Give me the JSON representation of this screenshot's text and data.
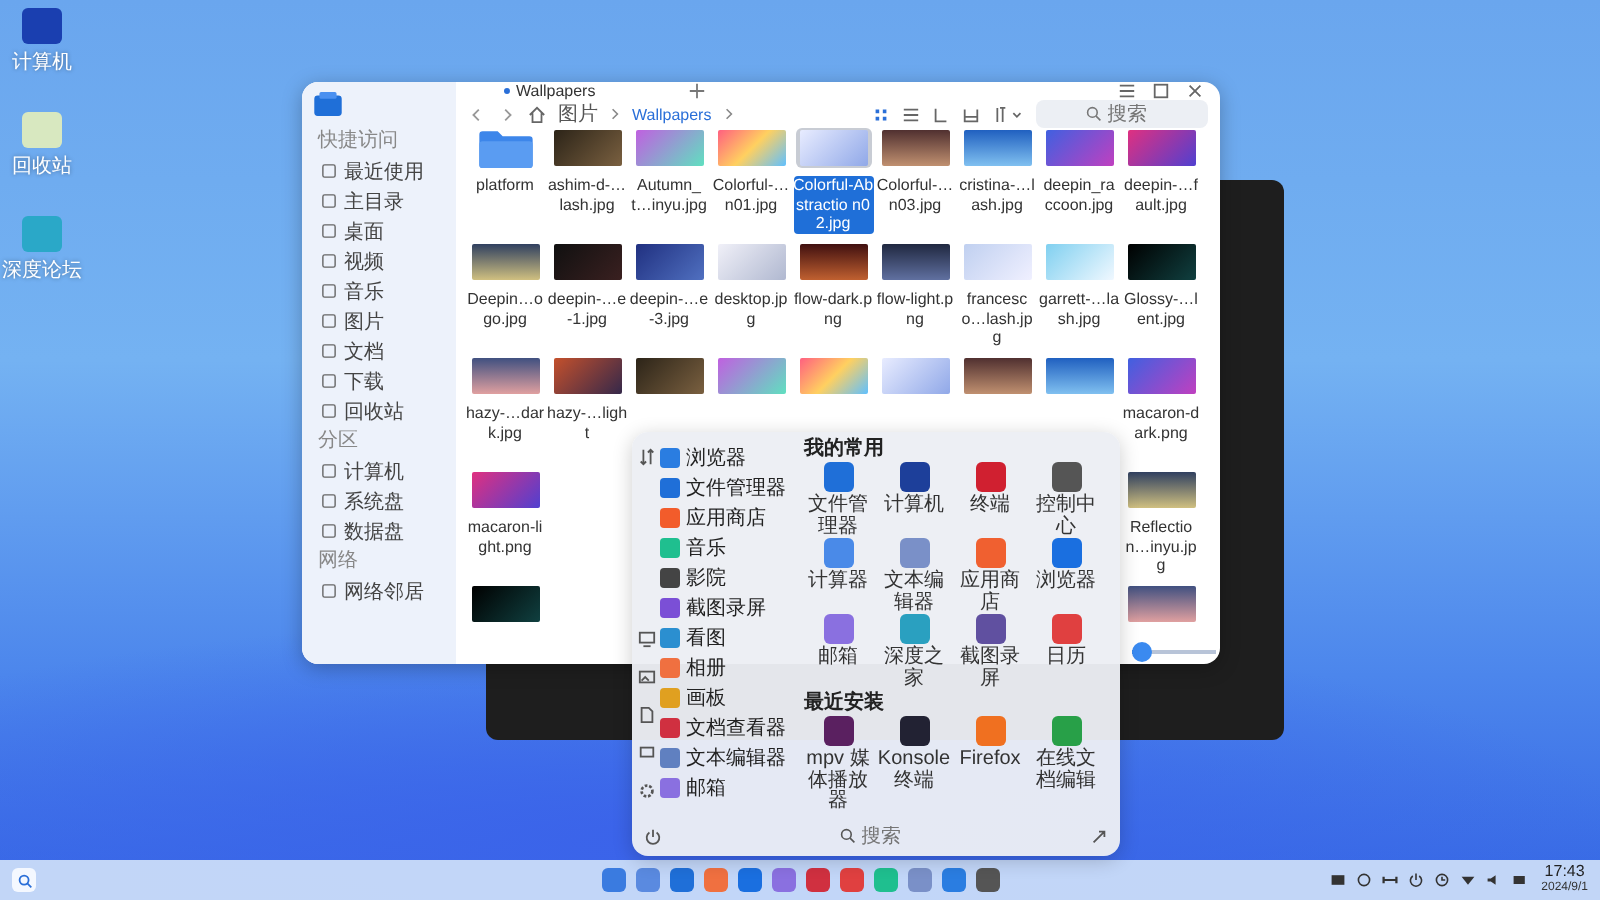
{
  "desktop_icons": [
    {
      "label": "计算机"
    },
    {
      "label": "回收站"
    },
    {
      "label": "深度论坛"
    }
  ],
  "file_manager": {
    "tab": "Wallpapers",
    "sidebar": [
      {
        "kind": "heading",
        "label": "快捷访问"
      },
      {
        "kind": "item",
        "label": "最近使用"
      },
      {
        "kind": "item",
        "label": "主目录"
      },
      {
        "kind": "item",
        "label": "桌面"
      },
      {
        "kind": "item",
        "label": "视频"
      },
      {
        "kind": "item",
        "label": "音乐"
      },
      {
        "kind": "item",
        "label": "图片"
      },
      {
        "kind": "item",
        "label": "文档"
      },
      {
        "kind": "item",
        "label": "下载"
      },
      {
        "kind": "item",
        "label": "回收站"
      },
      {
        "kind": "heading",
        "label": "分区"
      },
      {
        "kind": "item",
        "label": "计算机"
      },
      {
        "kind": "item",
        "label": "系统盘"
      },
      {
        "kind": "item",
        "label": "数据盘"
      },
      {
        "kind": "heading",
        "label": "网络"
      },
      {
        "kind": "item",
        "label": "网络邻居"
      }
    ],
    "breadcrumb": [
      "图片",
      "Wallpapers"
    ],
    "search": {
      "placeholder": "搜索"
    },
    "files": [
      [
        {
          "kind": "folder",
          "name": "platform",
          "selected": false
        },
        {
          "kind": "image",
          "name": "ashim-d-…lash.jpg",
          "selected": false
        },
        {
          "kind": "image",
          "name": "Autumn_t…inyu.jpg",
          "selected": false
        },
        {
          "kind": "image",
          "name": "Colorful-…n01.jpg",
          "selected": false
        },
        {
          "kind": "image",
          "name": "Colorful-Abstractio n02.jpg",
          "selected": true
        },
        {
          "kind": "image",
          "name": "Colorful-…n03.jpg",
          "selected": false
        },
        {
          "kind": "image",
          "name": "cristina-…lash.jpg",
          "selected": false
        },
        {
          "kind": "image",
          "name": "deepin_ra ccoon.jpg",
          "selected": false
        },
        {
          "kind": "image",
          "name": "deepin-…fault.jpg",
          "selected": false
        }
      ],
      [
        {
          "kind": "image",
          "name": "Deepin…ogo.jpg",
          "selected": false
        },
        {
          "kind": "image",
          "name": "deepin-…e-1.jpg",
          "selected": false
        },
        {
          "kind": "image",
          "name": "deepin-…e-3.jpg",
          "selected": false
        },
        {
          "kind": "image",
          "name": "desktop.jp g",
          "selected": false
        },
        {
          "kind": "image",
          "name": "flow-dark.png",
          "selected": false
        },
        {
          "kind": "image",
          "name": "flow-light.png",
          "selected": false
        },
        {
          "kind": "image",
          "name": "francesco…lash.jpg",
          "selected": false
        },
        {
          "kind": "image",
          "name": "garrett-…lash.jpg",
          "selected": false
        },
        {
          "kind": "image",
          "name": "Glossy-…lent.jpg",
          "selected": false
        }
      ],
      [
        {
          "kind": "image",
          "name": "hazy-…dark.jpg",
          "selected": false
        },
        {
          "kind": "image",
          "name": "hazy-…light",
          "selected": false
        },
        {
          "kind": "image",
          "selected": false
        },
        {
          "kind": "image",
          "selected": false
        },
        {
          "kind": "image",
          "selected": false
        },
        {
          "kind": "image",
          "selected": false
        },
        {
          "kind": "image",
          "selected": false
        },
        {
          "kind": "image",
          "selected": false
        },
        {
          "kind": "image",
          "name": "macaron-dark.png",
          "selected": false
        }
      ],
      [
        {
          "kind": "image",
          "name": "macaron-light.png",
          "selected": false
        },
        {
          "kind": "image",
          "name": "Reflection…inyu.jpg",
          "selected": false
        }
      ],
      [
        {
          "kind": "image",
          "selected": false
        },
        {
          "kind": "image",
          "selected": false
        }
      ]
    ],
    "zoom_slider": {
      "level": 0.12
    }
  },
  "launcher": {
    "apps": [
      {
        "label": "浏览器"
      },
      {
        "label": "文件管理器"
      },
      {
        "label": "应用商店"
      },
      {
        "label": "音乐"
      },
      {
        "label": "影院"
      },
      {
        "label": "截图录屏"
      },
      {
        "label": "看图"
      },
      {
        "label": "相册"
      },
      {
        "label": "画板"
      },
      {
        "label": "文档查看器"
      },
      {
        "label": "文本编辑器"
      },
      {
        "label": "邮箱"
      }
    ],
    "favorites_title": "我的常用",
    "favorites": [
      {
        "label": "文件管理器"
      },
      {
        "label": "计算机"
      },
      {
        "label": "终端"
      },
      {
        "label": "控制中心"
      },
      {
        "label": "计算器"
      },
      {
        "label": "文本编辑器"
      },
      {
        "label": "应用商店"
      },
      {
        "label": "浏览器"
      },
      {
        "label": "邮箱"
      },
      {
        "label": "深度之家"
      },
      {
        "label": "截图录屏"
      },
      {
        "label": "日历"
      }
    ],
    "recent_title": "最近安装",
    "recent": [
      {
        "label": "mpv 媒体播放器"
      },
      {
        "label": "Konsole 终端"
      },
      {
        "label": "Firefox"
      },
      {
        "label": "在线文档编辑"
      }
    ],
    "search": {
      "placeholder": "搜索"
    }
  },
  "taskbar": {
    "time": "17:43",
    "date": "2024/9/1"
  }
}
